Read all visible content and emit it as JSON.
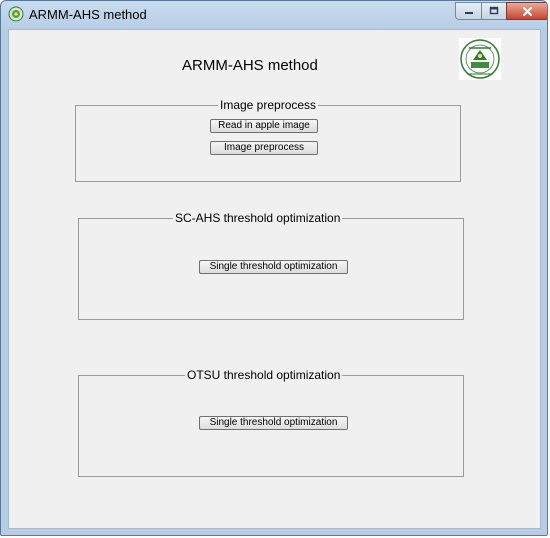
{
  "window": {
    "title": "ARMM-AHS method",
    "controls": {
      "minimize_icon": "minimize-icon",
      "maximize_icon": "maximize-icon",
      "close_icon": "close-icon"
    }
  },
  "main": {
    "title": "ARMM-AHS method",
    "logo_icon": "university-seal-icon"
  },
  "groups": {
    "preprocess": {
      "label": "Image preprocess",
      "buttons": [
        "Read in apple image",
        "Image preprocess"
      ]
    },
    "scahs": {
      "label": "SC-AHS threshold optimization",
      "button": "Single threshold optimization"
    },
    "otsu": {
      "label": "OTSU threshold optimization",
      "button": "Single threshold optimization"
    }
  },
  "colors": {
    "titlebar": "#b6cde6",
    "client_bg": "#f0f0f0",
    "close_button": "#c8452f",
    "group_border": "#9a9a9a"
  }
}
